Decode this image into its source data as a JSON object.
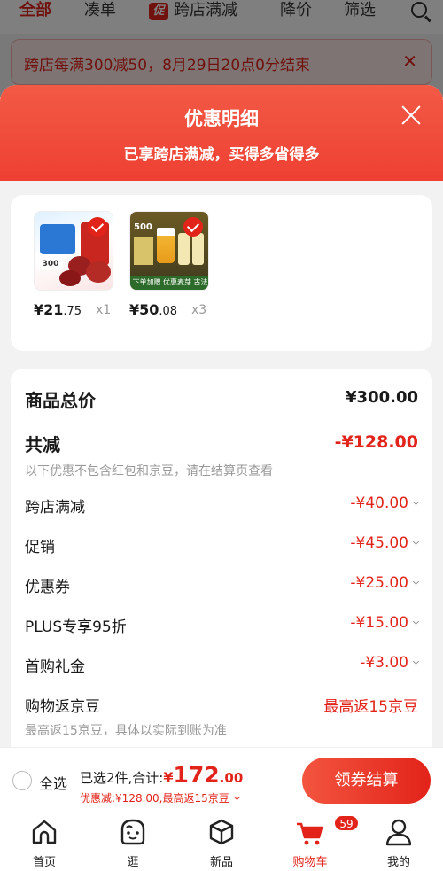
{
  "background": {
    "tabs": [
      "全部",
      "凑单",
      "跨店满减",
      "降价",
      "筛选"
    ],
    "promo_chip": "促",
    "banner_text": "跨店每满300减50，8月29日20点0分结束"
  },
  "sheet": {
    "title": "优惠明细",
    "subtitle": "已享跨店满减，买得多省得多"
  },
  "products": [
    {
      "yen": "¥",
      "int": "21",
      "dec": ".75",
      "qty": "x1",
      "image": "red-dates-pack"
    },
    {
      "yen": "¥",
      "int": "50",
      "dec": ".08",
      "qty": "x3",
      "image": "beer-pack"
    }
  ],
  "product_image_text": {
    "dates_num": "300",
    "beer_num": "500",
    "beer_strip": "下单加赠  优惠麦芽 古法精酿"
  },
  "summary": {
    "total_label": "商品总价",
    "total_value": "¥300.00",
    "discount_label": "共减",
    "discount_value": "-¥128.00",
    "discount_note": "以下优惠不包含红包和京豆，请在结算页查看",
    "items": [
      {
        "label": "跨店满减",
        "value": "-¥40.00"
      },
      {
        "label": "促销",
        "value": "-¥45.00"
      },
      {
        "label": "优惠券",
        "value": "-¥25.00"
      },
      {
        "label": "PLUS专享95折",
        "value": "-¥15.00"
      },
      {
        "label": "首购礼金",
        "value": "-¥3.00"
      }
    ],
    "jingdou_label": "购物返京豆",
    "jingdou_value": "最高返15京豆",
    "jingdou_note": "最高返15京豆，具体以实际到账为准"
  },
  "checkout": {
    "select_all": "全选",
    "selected_text": "已选2件,合计:",
    "total_yen": "¥",
    "total_int": "172",
    "total_dec": ".00",
    "savings_text": "优惠减:¥128.00,最高返15京豆",
    "pay_button": "领券结算"
  },
  "tabbar": {
    "items": [
      "首页",
      "逛",
      "新品",
      "购物车",
      "我的"
    ],
    "cart_badge": "59",
    "active": "购物车"
  },
  "colors": {
    "accent": "#e2231a",
    "header_gradient_top": "#f25a45"
  }
}
